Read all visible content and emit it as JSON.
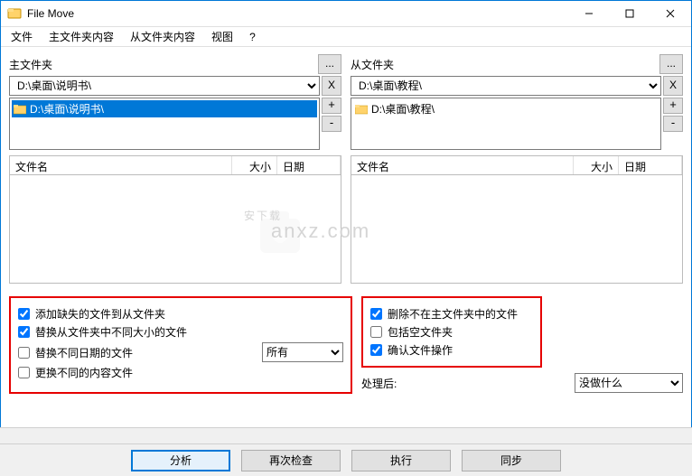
{
  "window": {
    "title": "File Move"
  },
  "menu": {
    "file": "文件",
    "main_content": "主文件夹内容",
    "sub_content": "从文件夹内容",
    "view": "视图",
    "help": "?"
  },
  "left": {
    "label": "主文件夹",
    "path": "D:\\桌面\\说明书\\",
    "tree_item": "D:\\桌面\\说明书\\",
    "cols": {
      "name": "文件名",
      "size": "大小",
      "date": "日期"
    }
  },
  "right": {
    "label": "从文件夹",
    "path": "D:\\桌面\\教程\\",
    "tree_item": "D:\\桌面\\教程\\",
    "cols": {
      "name": "文件名",
      "size": "大小",
      "date": "日期"
    }
  },
  "opts_left": {
    "add_missing": "添加缺失的文件到从文件夹",
    "replace_diff_size": "替换从文件夹中不同大小的文件",
    "replace_diff_date": "替换不同日期的文件",
    "replace_diff_content": "更换不同的内容文件",
    "date_scope": "所有"
  },
  "opts_right": {
    "delete_not_in_main": "删除不在主文件夹中的文件",
    "include_empty": "包括空文件夹",
    "confirm_ops": "确认文件操作",
    "after_label": "处理后:",
    "after_value": "没做什么"
  },
  "buttons": {
    "analyze": "分析",
    "recheck": "再次检查",
    "execute": "执行",
    "sync": "同步"
  },
  "glyph": {
    "dots": "...",
    "x": "X",
    "plus": "+",
    "minus": "-"
  }
}
